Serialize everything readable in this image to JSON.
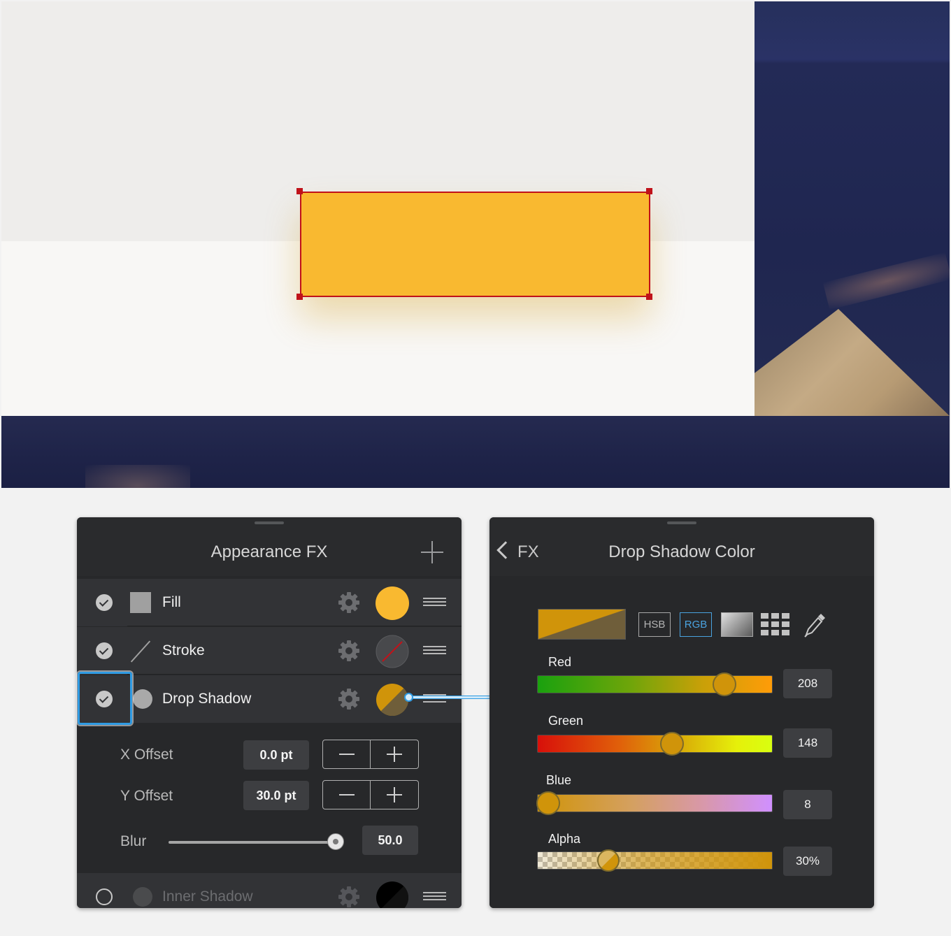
{
  "canvas": {
    "shape_fill": "#f9b930",
    "selection_color": "#c0121a"
  },
  "appearance_panel": {
    "title": "Appearance FX",
    "effects": [
      {
        "label": "Fill",
        "enabled": true,
        "swatch": "#f9b930",
        "icon": "square-fill-icon"
      },
      {
        "label": "Stroke",
        "enabled": true,
        "swatch": "none",
        "icon": "stroke-line-icon"
      },
      {
        "label": "Drop Shadow",
        "enabled": true,
        "selected": true,
        "swatch": "#d0940a",
        "icon": "drop-shadow-icon"
      },
      {
        "label": "Inner Shadow",
        "enabled": false,
        "swatch": "#000000",
        "icon": "inner-shadow-icon"
      }
    ],
    "properties": {
      "x_offset_label": "X Offset",
      "x_offset_value": "0.0 pt",
      "y_offset_label": "Y Offset",
      "y_offset_value": "30.0 pt",
      "blur_label": "Blur",
      "blur_value": "50.0",
      "blur_slider_fraction": 0.97
    }
  },
  "color_panel": {
    "back_label": "FX",
    "title": "Drop Shadow Color",
    "modes": [
      "HSB",
      "RGB"
    ],
    "active_mode": "RGB",
    "sliders": [
      {
        "label": "Red",
        "value": "208",
        "fraction": 0.8157
      },
      {
        "label": "Green",
        "value": "148",
        "fraction": 0.5804
      },
      {
        "label": "Blue",
        "value": "8",
        "fraction": 0.0314
      },
      {
        "label": "Alpha",
        "value": "30%",
        "fraction": 0.3
      }
    ],
    "preview_color": "#d0940a",
    "accent": "#4aa3e0"
  }
}
